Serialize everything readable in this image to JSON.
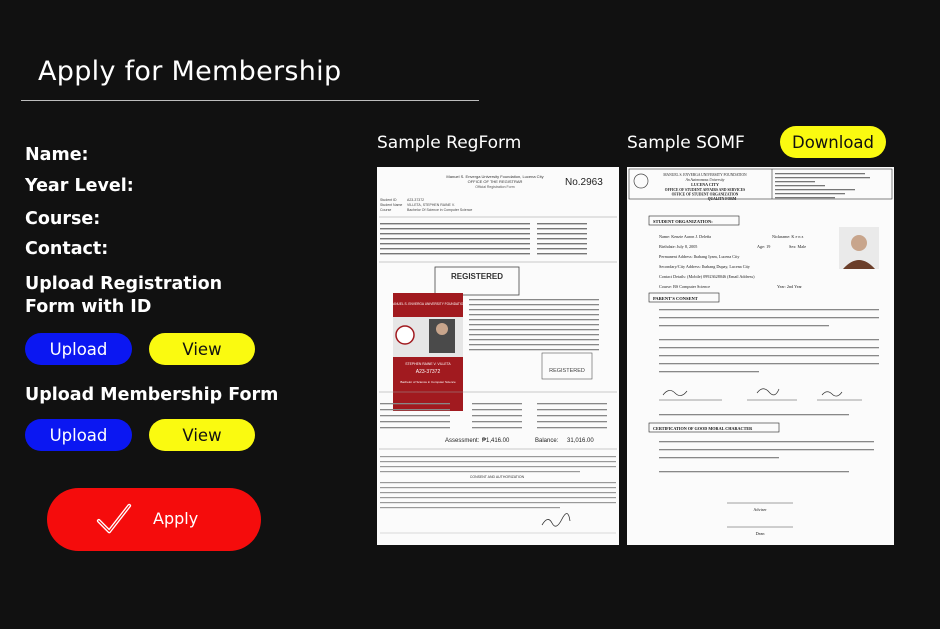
{
  "page": {
    "title": "Apply for Membership"
  },
  "form": {
    "name_label": "Name:",
    "year_label": "Year Level:",
    "course_label": "Course:",
    "contact_label": "Contact:",
    "regform_label_line1": "Upload Registration",
    "regform_label_line2": "Form with ID",
    "somf_label": "Upload Membership Form",
    "upload_label": "Upload",
    "view_label": "View",
    "apply_label": "Apply"
  },
  "samples": {
    "regform_title": "Sample RegForm",
    "somf_title": "Sample SOMF",
    "download_label": "Download"
  },
  "regform_doc": {
    "university": "Manuel S. Enverga University Foundation, Lucena City",
    "office": "OFFICE OF THE REGISTRAR",
    "form_title": "Official Registration Form",
    "form_no": "No.2963",
    "student_id": "A23-37372",
    "student_name": "VILLETA, STEPHEN RAINE V.",
    "course": "Bachelor Of Science in Computer Science",
    "registered_stamp": "REGISTERED",
    "id_university": "MANUEL S. ENVERGA UNIVERSITY FOUNDATION",
    "id_name": "STEPHEN RAINE V. VILLETA",
    "id_number": "A23-37372",
    "id_course": "Bachelor of Science in Computer Science",
    "assessment_label": "Assessment:",
    "assessment_value": "₱1,416.00",
    "balance_label": "Balance:",
    "balance_value": "31,016.00",
    "consent_title": "CONSENT AND AUTHORIZATION"
  },
  "somf_doc": {
    "university": "MANUEL S. ENVERGA UNIVERSITY FOUNDATION",
    "autonomous": "An Autonomous University",
    "city": "LUCENA CITY",
    "office": "OFFICE OF STUDENT AFFAIRS AND SERVICES",
    "office2": "OFFICE OF STUDENT ORGANIZATION",
    "quality": "QUALITY FORM",
    "sec1": "STUDENT ORGANIZATION:",
    "name_line": "Name: Kenzie Aaron J. Deleña",
    "nickname": "Nickname: K e n z",
    "birthdate": "Birthdate: July 8, 2005",
    "age": "Age: 19",
    "sex": "Sex: Male",
    "permanent": "Permanent Address: Ibabang Iyam, Lucena City",
    "secondary": "Secondary/City Address: Ibabang Dupay, Lucena City",
    "contact": "Contact Details: (Mobile) 09923628046  (Email Address)",
    "course": "Course: BS Computer Science",
    "year": "Year: 2nd Year",
    "sec2": "PARENT'S CONSENT",
    "sec3": "CERTIFICATION OF GOOD MORAL CHARACTER",
    "adviser": "Adviser",
    "dean": "Dean"
  }
}
